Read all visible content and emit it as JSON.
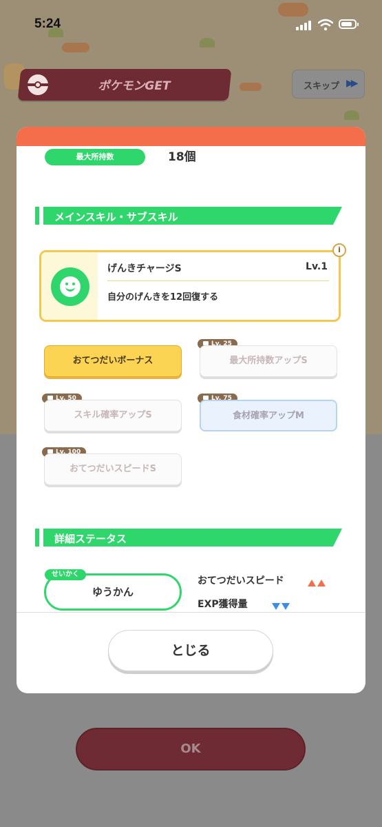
{
  "status_bar": {
    "time": "5:24",
    "icons": [
      "signal-icon",
      "wifi-icon",
      "battery-icon"
    ]
  },
  "background": {
    "get_banner_label": "ポケモンGET",
    "skip_label": "スキップ",
    "skip_icon": "fast-forward-icon",
    "ok_label": "OK"
  },
  "modal": {
    "max_hold": {
      "label": "最大所持数",
      "value": "18個"
    },
    "skills_section_title": "メインスキル・サブスキル",
    "main_skill": {
      "name": "げんきチャージS",
      "level": "Lv.1",
      "description": "自分のげんきを12回復する",
      "icon": "smile-face-icon"
    },
    "info_icon_text": "i",
    "sub_skills": [
      {
        "label": "おてつだいボーナス",
        "lock": "",
        "state": "active"
      },
      {
        "label": "最大所持数アップS",
        "lock": "Lv. 25",
        "state": "locked"
      },
      {
        "label": "スキル確率アップS",
        "lock": "Lv. 50",
        "state": "locked"
      },
      {
        "label": "食材確率アップM",
        "lock": "Lv. 75",
        "state": "locked-ingredient"
      },
      {
        "label": "おてつだいスピードS",
        "lock": "Lv. 100",
        "state": "locked"
      }
    ],
    "details_section_title": "詳細ステータス",
    "nature": {
      "tag": "せいかく",
      "value": "ゆうかん"
    },
    "stats": [
      {
        "label": "おてつだいスピード",
        "direction": "up",
        "count": 2
      },
      {
        "label": "EXP獲得量",
        "direction": "down",
        "count": 2
      }
    ],
    "close_label": "とじる"
  },
  "colors": {
    "accent_green": "#2fd66b",
    "header_orange": "#f46e4c",
    "banner_maroon": "#6e2b33",
    "skill_gold": "#f4c84f",
    "up_arrow": "#f46e4c",
    "down_arrow": "#3c8de8"
  }
}
